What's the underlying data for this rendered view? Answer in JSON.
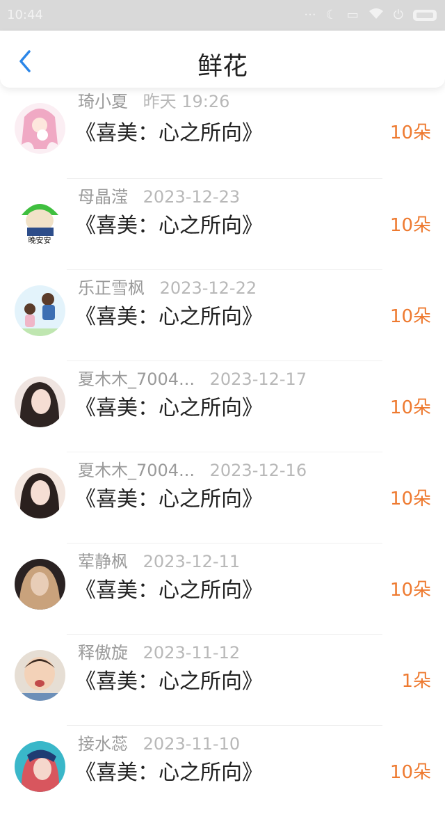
{
  "status": {
    "time": "10:44"
  },
  "header": {
    "title": "鲜花"
  },
  "items": [
    {
      "name": "琦小夏",
      "date": "昨天 19:26",
      "book": "《喜美：心之所向》",
      "count": "10朵",
      "avatar_colors": [
        "#f7d9e6",
        "#f2b9cf"
      ]
    },
    {
      "name": "母晶滢",
      "date": "2023-12-23",
      "book": "《喜美：心之所向》",
      "count": "10朵",
      "avatar_colors": [
        "#3fbf3f",
        "#2a8a2a"
      ],
      "avatar_text": "晚安安"
    },
    {
      "name": "乐正雪枫",
      "date": "2023-12-22",
      "book": "《喜美：心之所向》",
      "count": "10朵",
      "avatar_colors": [
        "#cfe9f6",
        "#9ad0ec"
      ]
    },
    {
      "name": "夏木木_7004...",
      "date": "2023-12-17",
      "book": "《喜美：心之所向》",
      "count": "10朵",
      "avatar_colors": [
        "#e8d6d0",
        "#4a3a38"
      ]
    },
    {
      "name": "夏木木_7004...",
      "date": "2023-12-16",
      "book": "《喜美：心之所向》",
      "count": "10朵",
      "avatar_colors": [
        "#eed7cf",
        "#3e2f2c"
      ]
    },
    {
      "name": "荤静枫",
      "date": "2023-12-11",
      "book": "《喜美：心之所向》",
      "count": "10朵",
      "avatar_colors": [
        "#d9b99b",
        "#2a2a2a"
      ]
    },
    {
      "name": "释傲旋",
      "date": "2023-11-12",
      "book": "《喜美：心之所向》",
      "count": "1朵",
      "avatar_colors": [
        "#e9ddd0",
        "#a8855f"
      ]
    },
    {
      "name": "接水蕊",
      "date": "2023-11-10",
      "book": "《喜美：心之所向》",
      "count": "10朵",
      "avatar_colors": [
        "#3ab7c9",
        "#d8565e"
      ]
    }
  ]
}
